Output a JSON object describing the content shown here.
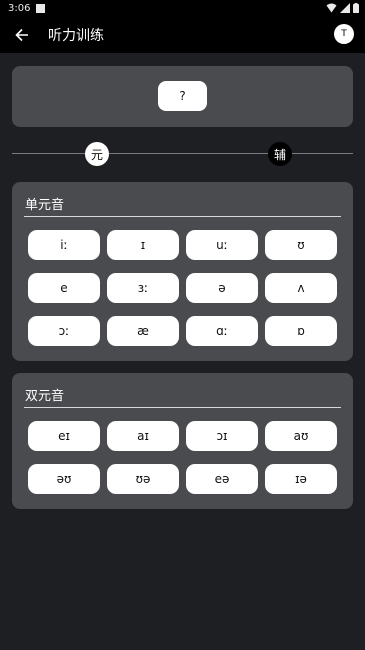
{
  "status_bar": {
    "time": "3:06"
  },
  "app_bar": {
    "title": "听力训练",
    "translate_label": "T"
  },
  "question": {
    "label": "?"
  },
  "mode_switch": {
    "vowel_label": "元",
    "consonant_label": "辅"
  },
  "monophthongs": {
    "title": "单元音",
    "items": [
      "iː",
      "ɪ",
      "uː",
      "ʊ",
      "e",
      "ɜː",
      "ə",
      "ʌ",
      "ɔː",
      "æ",
      "ɑː",
      "ɒ"
    ]
  },
  "diphthongs": {
    "title": "双元音",
    "items": [
      "eɪ",
      "aɪ",
      "ɔɪ",
      "aʊ",
      "əʊ",
      "ʊə",
      "eə",
      "ɪə"
    ]
  },
  "colors": {
    "background": "#1e1f23",
    "card": "#4a4b4f",
    "bar": "#000000",
    "button": "#ffffff"
  }
}
